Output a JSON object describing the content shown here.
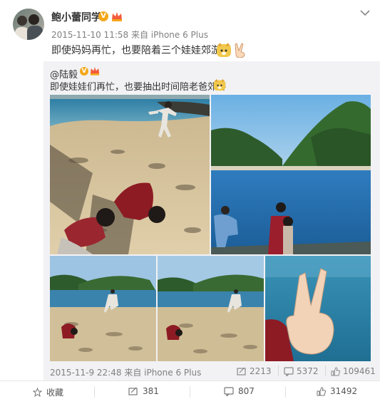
{
  "post": {
    "username": "鲍小蕾同学",
    "meta": "2015-11-10 11:58 来自 iPhone 6 Plus",
    "text": "即使妈妈再忙，也要陪着三个娃娃郊游。"
  },
  "repost": {
    "username": "@陆毅",
    "text": "即使娃娃们再忙，也要抽出时间陪老爸郊游",
    "meta": "2015-11-9 22:48 来自 iPhone 6 Plus",
    "stats": {
      "reposts": "2213",
      "comments": "5372",
      "likes": "109461"
    }
  },
  "footer": {
    "favorite": "收藏",
    "reposts": "381",
    "comments": "807",
    "likes": "31492"
  },
  "icons": {
    "verified": "V",
    "repost": "repost-icon",
    "comment": "comment-icon",
    "like": "thumb-up-icon",
    "favorite": "star-icon",
    "menu": "chevron-down-icon"
  },
  "colors": {
    "badge": "#f3a71a",
    "meta": "#808080",
    "repost_bg": "#f2f2f5"
  }
}
